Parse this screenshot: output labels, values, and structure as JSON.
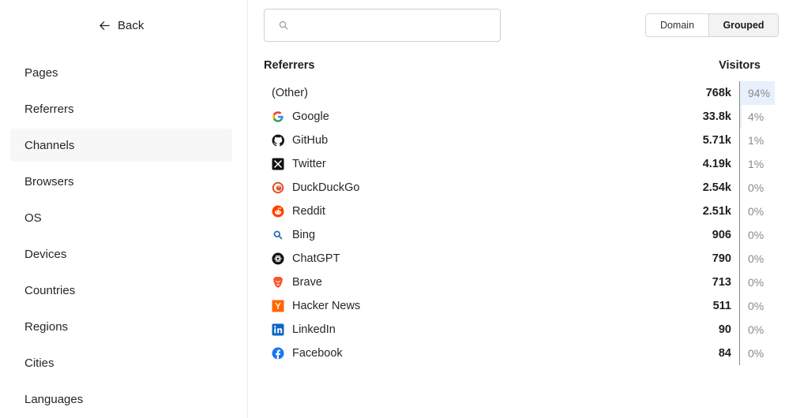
{
  "sidebar": {
    "back_label": "Back",
    "items": [
      {
        "label": "Pages",
        "active": false
      },
      {
        "label": "Referrers",
        "active": false
      },
      {
        "label": "Channels",
        "active": true
      },
      {
        "label": "Browsers",
        "active": false
      },
      {
        "label": "OS",
        "active": false
      },
      {
        "label": "Devices",
        "active": false
      },
      {
        "label": "Countries",
        "active": false
      },
      {
        "label": "Regions",
        "active": false
      },
      {
        "label": "Cities",
        "active": false
      },
      {
        "label": "Languages",
        "active": false
      }
    ]
  },
  "search": {
    "value": "",
    "placeholder": ""
  },
  "view_toggle": {
    "domain_label": "Domain",
    "grouped_label": "Grouped",
    "selected": "Grouped"
  },
  "table": {
    "referrers_header": "Referrers",
    "visitors_header": "Visitors",
    "rows": [
      {
        "name": "(Other)",
        "icon": "",
        "count": "768k",
        "pct": "94%",
        "share": 0.94
      },
      {
        "name": "Google",
        "icon": "google-icon",
        "count": "33.8k",
        "pct": "4%",
        "share": 0.04
      },
      {
        "name": "GitHub",
        "icon": "github-icon",
        "count": "5.71k",
        "pct": "1%",
        "share": 0.01
      },
      {
        "name": "Twitter",
        "icon": "x-twitter-icon",
        "count": "4.19k",
        "pct": "1%",
        "share": 0.01
      },
      {
        "name": "DuckDuckGo",
        "icon": "duckduckgo-icon",
        "count": "2.54k",
        "pct": "0%",
        "share": 0
      },
      {
        "name": "Reddit",
        "icon": "reddit-icon",
        "count": "2.51k",
        "pct": "0%",
        "share": 0
      },
      {
        "name": "Bing",
        "icon": "bing-search-icon",
        "count": "906",
        "pct": "0%",
        "share": 0
      },
      {
        "name": "ChatGPT",
        "icon": "chatgpt-icon",
        "count": "790",
        "pct": "0%",
        "share": 0
      },
      {
        "name": "Brave",
        "icon": "brave-icon",
        "count": "713",
        "pct": "0%",
        "share": 0
      },
      {
        "name": "Hacker News",
        "icon": "hacker-news-icon",
        "count": "511",
        "pct": "0%",
        "share": 0
      },
      {
        "name": "LinkedIn",
        "icon": "linkedin-icon",
        "count": "90",
        "pct": "0%",
        "share": 0
      },
      {
        "name": "Facebook",
        "icon": "facebook-icon",
        "count": "84",
        "pct": "0%",
        "share": 0
      }
    ]
  },
  "colors": {
    "bar_fill": "#e7f0fb",
    "muted_text": "#8a8a8a"
  }
}
